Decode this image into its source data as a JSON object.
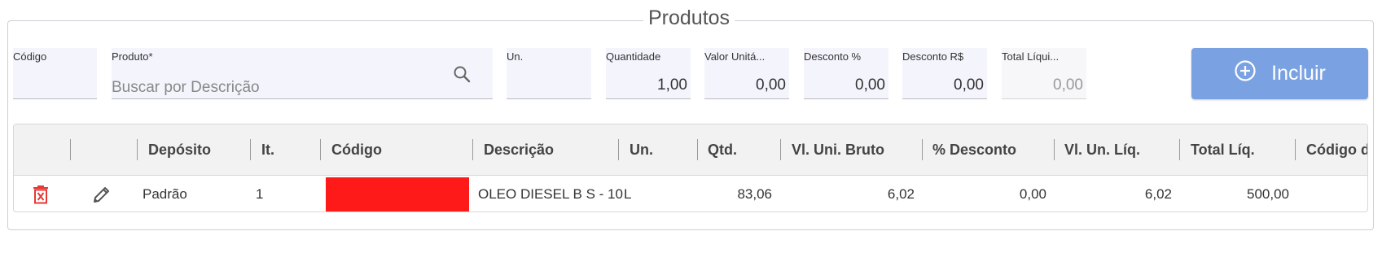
{
  "section": {
    "title": "Produtos"
  },
  "form": {
    "codigo": {
      "label": "Código",
      "value": ""
    },
    "produto": {
      "label": "Produto*",
      "placeholder": "Buscar por Descrição"
    },
    "un": {
      "label": "Un.",
      "value": ""
    },
    "quantidade": {
      "label": "Quantidade",
      "value": "1,00"
    },
    "valor_unitario": {
      "label": "Valor Unitá...",
      "value": "0,00"
    },
    "desconto_pct": {
      "label": "Desconto %",
      "value": "0,00"
    },
    "desconto_rs": {
      "label": "Desconto R$",
      "value": "0,00"
    },
    "total_liquido": {
      "label": "Total Líqui...",
      "value": "0,00"
    },
    "incluir_label": "Incluir"
  },
  "table": {
    "headers": {
      "deposito": "Depósito",
      "item": "It.",
      "codigo": "Código",
      "descricao": "Descrição",
      "un": "Un.",
      "qtd": "Qtd.",
      "vl_uni_bruto": "Vl. Uni. Bruto",
      "pct_desconto": "% Desconto",
      "vl_un_liq": "Vl. Un. Líq.",
      "total_liq": "Total Líq.",
      "codigo_do": "Código do"
    },
    "rows": [
      {
        "deposito": "Padrão",
        "item": "1",
        "descricao": "OLEO DIESEL B S - 10",
        "un": "L",
        "qtd": "83,06",
        "vl_uni_bruto": "6,02",
        "pct_desconto": "0,00",
        "vl_un_liq": "6,02",
        "total_liq": "500,00"
      }
    ]
  },
  "colors": {
    "accent": "#7aa2e3",
    "delete": "#e53935",
    "redacted": "#ff1a1a"
  },
  "icons": [
    "search-icon",
    "add-circle-icon",
    "delete-icon",
    "edit-icon"
  ]
}
